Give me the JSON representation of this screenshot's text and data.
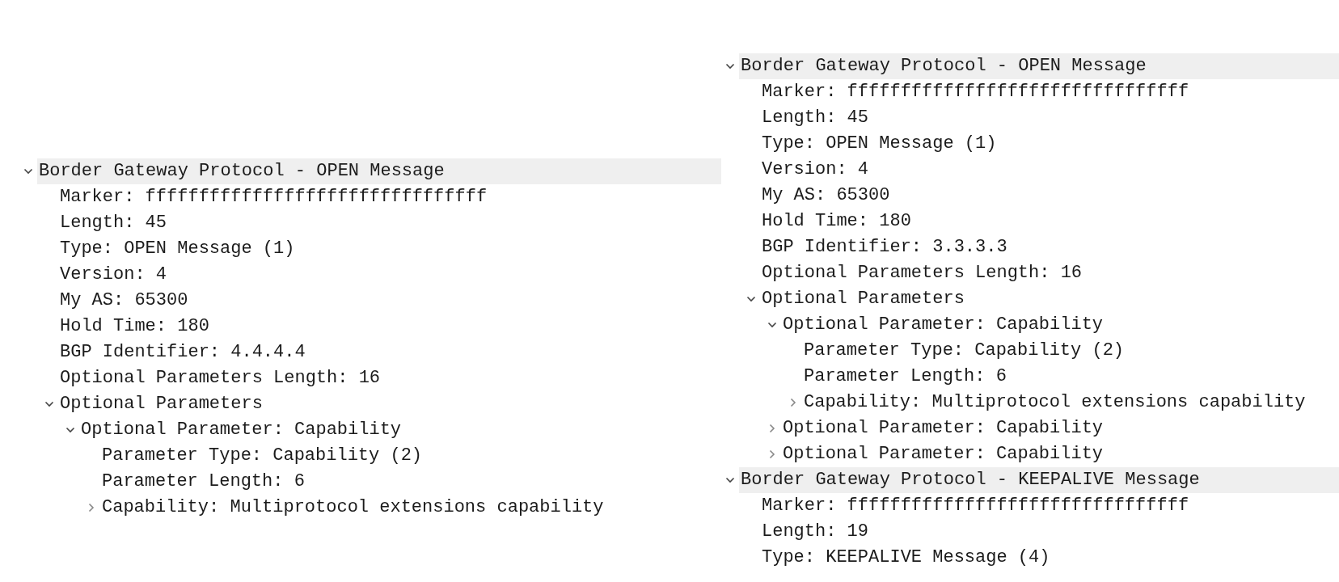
{
  "panels": [
    {
      "tree": [
        {
          "label": "Border Gateway Protocol - OPEN Message",
          "expanded": true,
          "children": [
            {
              "label": "Marker: ffffffffffffffffffffffffffffffff"
            },
            {
              "label": "Length: 45"
            },
            {
              "label": "Type: OPEN Message (1)"
            },
            {
              "label": "Version: 4"
            },
            {
              "label": "My AS: 65300"
            },
            {
              "label": "Hold Time: 180"
            },
            {
              "label": "BGP Identifier: 4.4.4.4"
            },
            {
              "label": "Optional Parameters Length: 16"
            },
            {
              "label": "Optional Parameters",
              "expanded": true,
              "children": [
                {
                  "label": "Optional Parameter: Capability",
                  "expanded": true,
                  "children": [
                    {
                      "label": "Parameter Type: Capability (2)"
                    },
                    {
                      "label": "Parameter Length: 6"
                    },
                    {
                      "label": "Capability: Multiprotocol extensions capability",
                      "expanded": false
                    }
                  ]
                }
              ]
            }
          ]
        }
      ]
    },
    {
      "tree": [
        {
          "label": "Border Gateway Protocol - OPEN Message",
          "expanded": true,
          "children": [
            {
              "label": "Marker: ffffffffffffffffffffffffffffffff"
            },
            {
              "label": "Length: 45"
            },
            {
              "label": "Type: OPEN Message (1)"
            },
            {
              "label": "Version: 4"
            },
            {
              "label": "My AS: 65300"
            },
            {
              "label": "Hold Time: 180"
            },
            {
              "label": "BGP Identifier: 3.3.3.3"
            },
            {
              "label": "Optional Parameters Length: 16"
            },
            {
              "label": "Optional Parameters",
              "expanded": true,
              "children": [
                {
                  "label": "Optional Parameter: Capability",
                  "expanded": true,
                  "children": [
                    {
                      "label": "Parameter Type: Capability (2)"
                    },
                    {
                      "label": "Parameter Length: 6"
                    },
                    {
                      "label": "Capability: Multiprotocol extensions capability",
                      "expanded": false
                    }
                  ]
                },
                {
                  "label": "Optional Parameter: Capability",
                  "expanded": false
                },
                {
                  "label": "Optional Parameter: Capability",
                  "expanded": false
                }
              ]
            }
          ]
        },
        {
          "label": "Border Gateway Protocol - KEEPALIVE Message",
          "expanded": true,
          "children": [
            {
              "label": "Marker: ffffffffffffffffffffffffffffffff"
            },
            {
              "label": "Length: 19"
            },
            {
              "label": "Type: KEEPALIVE Message (4)"
            }
          ]
        }
      ]
    }
  ]
}
